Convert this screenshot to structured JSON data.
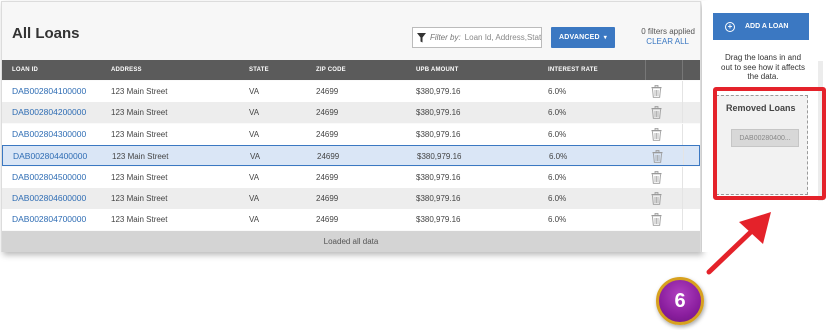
{
  "header": {
    "title": "All Loans",
    "filter_prefix": "Filter by:",
    "filter_placeholder": "Loan Id, Address,State",
    "advanced_label": "ADVANCED",
    "filters_applied": "0 filters applied",
    "clear_all": "CLEAR ALL"
  },
  "table": {
    "columns": [
      "LOAN ID",
      "ADDRESS",
      "STATE",
      "ZIP CODE",
      "UPB AMOUNT",
      "INTEREST RATE"
    ],
    "rows": [
      {
        "loan_id": "DAB002804100000",
        "address": "123 Main Street",
        "state": "VA",
        "zip": "24699",
        "upb": "$380,979.16",
        "rate": "6.0%"
      },
      {
        "loan_id": "DAB002804200000",
        "address": "123 Main Street",
        "state": "VA",
        "zip": "24699",
        "upb": "$380,979.16",
        "rate": "6.0%"
      },
      {
        "loan_id": "DAB002804300000",
        "address": "123 Main Street",
        "state": "VA",
        "zip": "24699",
        "upb": "$380,979.16",
        "rate": "6.0%"
      },
      {
        "loan_id": "DAB002804400000",
        "address": "123 Main Street",
        "state": "VA",
        "zip": "24699",
        "upb": "$380,979.16",
        "rate": "6.0%"
      },
      {
        "loan_id": "DAB002804500000",
        "address": "123 Main Street",
        "state": "VA",
        "zip": "24699",
        "upb": "$380,979.16",
        "rate": "6.0%"
      },
      {
        "loan_id": "DAB002804600000",
        "address": "123 Main Street",
        "state": "VA",
        "zip": "24699",
        "upb": "$380,979.16",
        "rate": "6.0%"
      },
      {
        "loan_id": "DAB002804700000",
        "address": "123 Main Street",
        "state": "VA",
        "zip": "24699",
        "upb": "$380,979.16",
        "rate": "6.0%"
      }
    ],
    "selected_row_index": 3,
    "footer": "Loaded all data"
  },
  "side": {
    "add_loan_label": "ADD A LOAN",
    "drag_text": "Drag the loans in and out to see how it affects the data.",
    "removed_title": "Removed Loans",
    "removed_chip": "DAB00280400..."
  },
  "annotation": {
    "step_number": "6"
  },
  "colors": {
    "accent": "#3b78c2",
    "header_bg": "#5b5b5b",
    "highlight": "#e4222a",
    "badge_fill": "#8a1e9e",
    "badge_ring": "#d7a11f"
  },
  "icons": [
    "filter-icon",
    "caret-down-icon",
    "trash-icon",
    "plus-circle-icon",
    "arrow-icon"
  ]
}
